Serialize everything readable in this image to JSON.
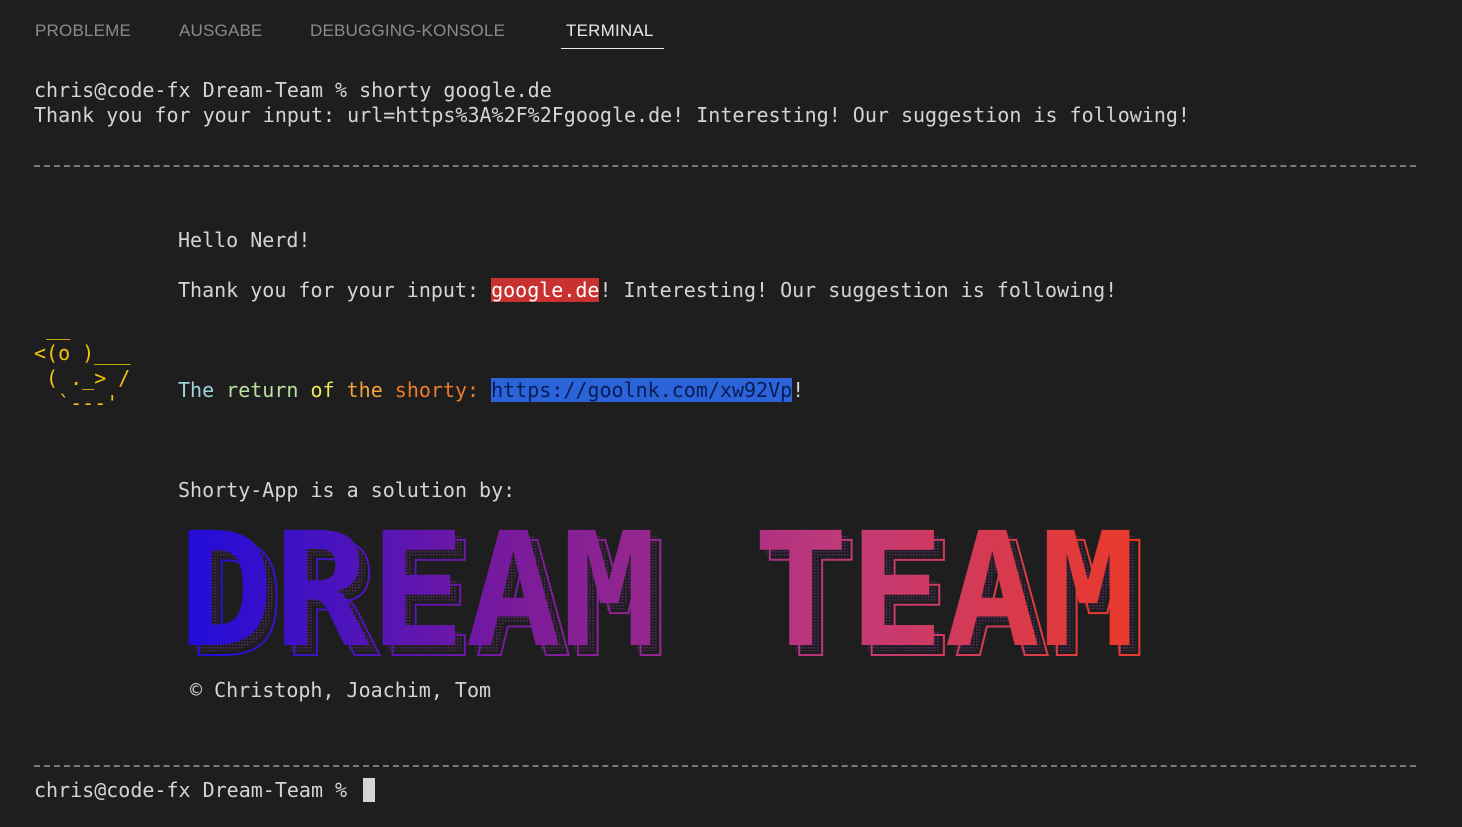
{
  "tabs": [
    {
      "label": "PROBLEME"
    },
    {
      "label": "AUSGABE"
    },
    {
      "label": "DEBUGGING-KONSOLE"
    },
    {
      "label": "TERMINAL",
      "active": true
    }
  ],
  "terminal": {
    "prompt1": "chris@code-fx Dream-Team % ",
    "command1": "shorty google.de",
    "output1": "Thank you for your input: url=https%3A%2F%2Fgoogle.de! Interesting! Our suggestion is following!",
    "greeting": "Hello Nerd!",
    "thanks_prefix": "Thank you for your input: ",
    "thanks_domain": "google.de",
    "thanks_suffix": "! Interesting! Our suggestion is following!",
    "duck_art": " __\n<(o )___\n ( ._> /\n  `---'",
    "return_words": [
      "The",
      "return",
      "of",
      "the",
      "shorty:"
    ],
    "short_url": "https://goolnk.com/xw92Vp",
    "exclaim": "!",
    "solution_by": "Shorty-App is a solution by:",
    "banner_text": "DREAM TEAM",
    "copyright": "© Christoph, Joachim, Tom",
    "prompt2": "chris@code-fx Dream-Team % "
  },
  "colors": {
    "background": "#1e1e1e",
    "text": "#d4d4d4",
    "highlight_red": "#c8312f",
    "highlight_blue": "#2b64d8",
    "duck": "#f1c40f",
    "return_gradient": [
      "#9fd3d8",
      "#b8e0a0",
      "#e8e65a",
      "#f2a23a",
      "#ef7a2a"
    ],
    "banner_gradient": [
      "#1f0cdb",
      "#7a1a9c",
      "#c23a78",
      "#ea3a2a"
    ]
  }
}
